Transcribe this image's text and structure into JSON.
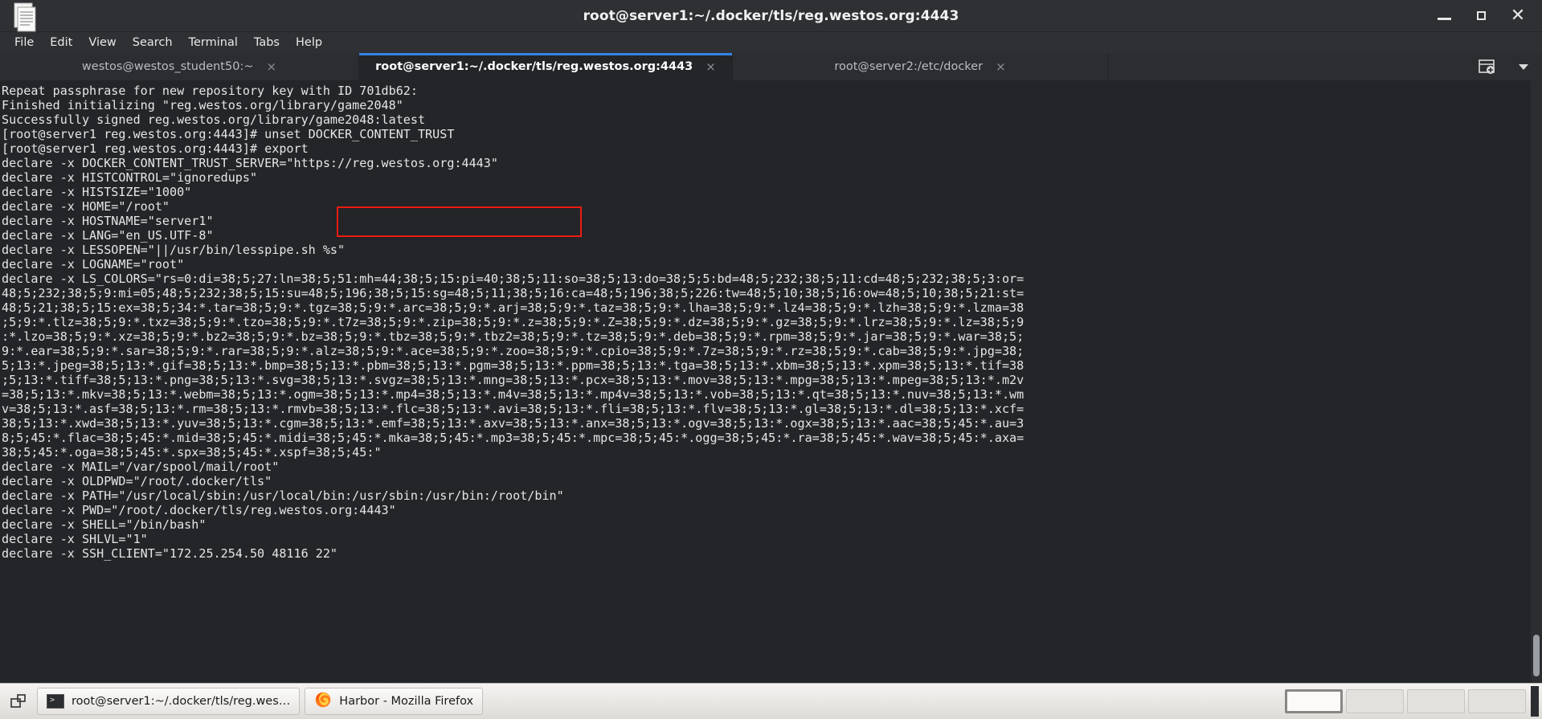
{
  "window": {
    "title": "root@server1:~/.docker/tls/reg.westos.org:4443",
    "app_icon": "terminal-document-icon",
    "controls": {
      "minimize": "minimize-icon",
      "maximize": "maximize-icon",
      "close": "close-icon"
    }
  },
  "menubar": {
    "items": [
      {
        "label": "File"
      },
      {
        "label": "Edit"
      },
      {
        "label": "View"
      },
      {
        "label": "Search"
      },
      {
        "label": "Terminal"
      },
      {
        "label": "Tabs"
      },
      {
        "label": "Help"
      }
    ]
  },
  "tabbar": {
    "tabs": [
      {
        "label": "westos@westos_student50:~",
        "active": false,
        "close": "×"
      },
      {
        "label": "root@server1:~/.docker/tls/reg.westos.org:4443",
        "active": true,
        "close": "×"
      },
      {
        "label": "root@server2:/etc/docker",
        "active": false,
        "close": "×"
      }
    ],
    "new_tab_icon": "new-tab-icon",
    "tab_menu_icon": "chevron-down-icon"
  },
  "terminal": {
    "prompt": "[root@server1 reg.westos.org:4443]#",
    "annotation": {
      "color": "#ee1b11",
      "shape": "rectangle"
    },
    "lines": [
      "Repeat passphrase for new repository key with ID 701db62:",
      "Finished initializing \"reg.westos.org/library/game2048\"",
      "Successfully signed reg.westos.org/library/game2048:latest",
      "[root@server1 reg.westos.org:4443]# unset DOCKER_CONTENT_TRUST",
      "[root@server1 reg.westos.org:4443]# export",
      "declare -x DOCKER_CONTENT_TRUST_SERVER=\"https://reg.westos.org:4443\"",
      "declare -x HISTCONTROL=\"ignoredups\"",
      "declare -x HISTSIZE=\"1000\"",
      "declare -x HOME=\"/root\"",
      "declare -x HOSTNAME=\"server1\"",
      "declare -x LANG=\"en_US.UTF-8\"",
      "declare -x LESSOPEN=\"||/usr/bin/lesspipe.sh %s\"",
      "declare -x LOGNAME=\"root\"",
      "declare -x LS_COLORS=\"rs=0:di=38;5;27:ln=38;5;51:mh=44;38;5;15:pi=40;38;5;11:so=38;5;13:do=38;5;5:bd=48;5;232;38;5;11:cd=48;5;232;38;5;3:or=",
      "48;5;232;38;5;9:mi=05;48;5;232;38;5;15:su=48;5;196;38;5;15:sg=48;5;11;38;5;16:ca=48;5;196;38;5;226:tw=48;5;10;38;5;16:ow=48;5;10;38;5;21:st=",
      "48;5;21;38;5;15:ex=38;5;34:*.tar=38;5;9:*.tgz=38;5;9:*.arc=38;5;9:*.arj=38;5;9:*.taz=38;5;9:*.lha=38;5;9:*.lz4=38;5;9:*.lzh=38;5;9:*.lzma=38",
      ";5;9:*.tlz=38;5;9:*.txz=38;5;9:*.tzo=38;5;9:*.t7z=38;5;9:*.zip=38;5;9:*.z=38;5;9:*.Z=38;5;9:*.dz=38;5;9:*.gz=38;5;9:*.lrz=38;5;9:*.lz=38;5;9",
      ":*.lzo=38;5;9:*.xz=38;5;9:*.bz2=38;5;9:*.bz=38;5;9:*.tbz=38;5;9:*.tbz2=38;5;9:*.tz=38;5;9:*.deb=38;5;9:*.rpm=38;5;9:*.jar=38;5;9:*.war=38;5;",
      "9:*.ear=38;5;9:*.sar=38;5;9:*.rar=38;5;9:*.alz=38;5;9:*.ace=38;5;9:*.zoo=38;5;9:*.cpio=38;5;9:*.7z=38;5;9:*.rz=38;5;9:*.cab=38;5;9:*.jpg=38;",
      "5;13:*.jpeg=38;5;13:*.gif=38;5;13:*.bmp=38;5;13:*.pbm=38;5;13:*.pgm=38;5;13:*.ppm=38;5;13:*.tga=38;5;13:*.xbm=38;5;13:*.xpm=38;5;13:*.tif=38",
      ";5;13:*.tiff=38;5;13:*.png=38;5;13:*.svg=38;5;13:*.svgz=38;5;13:*.mng=38;5;13:*.pcx=38;5;13:*.mov=38;5;13:*.mpg=38;5;13:*.mpeg=38;5;13:*.m2v",
      "=38;5;13:*.mkv=38;5;13:*.webm=38;5;13:*.ogm=38;5;13:*.mp4=38;5;13:*.m4v=38;5;13:*.mp4v=38;5;13:*.vob=38;5;13:*.qt=38;5;13:*.nuv=38;5;13:*.wm",
      "v=38;5;13:*.asf=38;5;13:*.rm=38;5;13:*.rmvb=38;5;13:*.flc=38;5;13:*.avi=38;5;13:*.fli=38;5;13:*.flv=38;5;13:*.gl=38;5;13:*.dl=38;5;13:*.xcf=",
      "38;5;13:*.xwd=38;5;13:*.yuv=38;5;13:*.cgm=38;5;13:*.emf=38;5;13:*.axv=38;5;13:*.anx=38;5;13:*.ogv=38;5;13:*.ogx=38;5;13:*.aac=38;5;45:*.au=3",
      "8;5;45:*.flac=38;5;45:*.mid=38;5;45:*.midi=38;5;45:*.mka=38;5;45:*.mp3=38;5;45:*.mpc=38;5;45:*.ogg=38;5;45:*.ra=38;5;45:*.wav=38;5;45:*.axa=",
      "38;5;45:*.oga=38;5;45:*.spx=38;5;45:*.xspf=38;5;45:\"",
      "declare -x MAIL=\"/var/spool/mail/root\"",
      "declare -x OLDPWD=\"/root/.docker/tls\"",
      "declare -x PATH=\"/usr/local/sbin:/usr/local/bin:/usr/sbin:/usr/bin:/root/bin\"",
      "declare -x PWD=\"/root/.docker/tls/reg.westos.org:4443\"",
      "declare -x SHELL=\"/bin/bash\"",
      "declare -x SHLVL=\"1\"",
      "declare -x SSH_CLIENT=\"172.25.254.50 48116 22\""
    ]
  },
  "taskbar": {
    "show_desktop_icon": "show-desktop-icon",
    "tasks": [
      {
        "label": "root@server1:~/.docker/tls/reg.wes…",
        "icon": "terminal-icon"
      },
      {
        "label": "Harbor - Mozilla Firefox",
        "icon": "firefox-icon"
      }
    ],
    "workspaces": [
      {
        "active": true
      },
      {
        "active": false
      },
      {
        "active": false
      },
      {
        "active": false
      }
    ]
  }
}
